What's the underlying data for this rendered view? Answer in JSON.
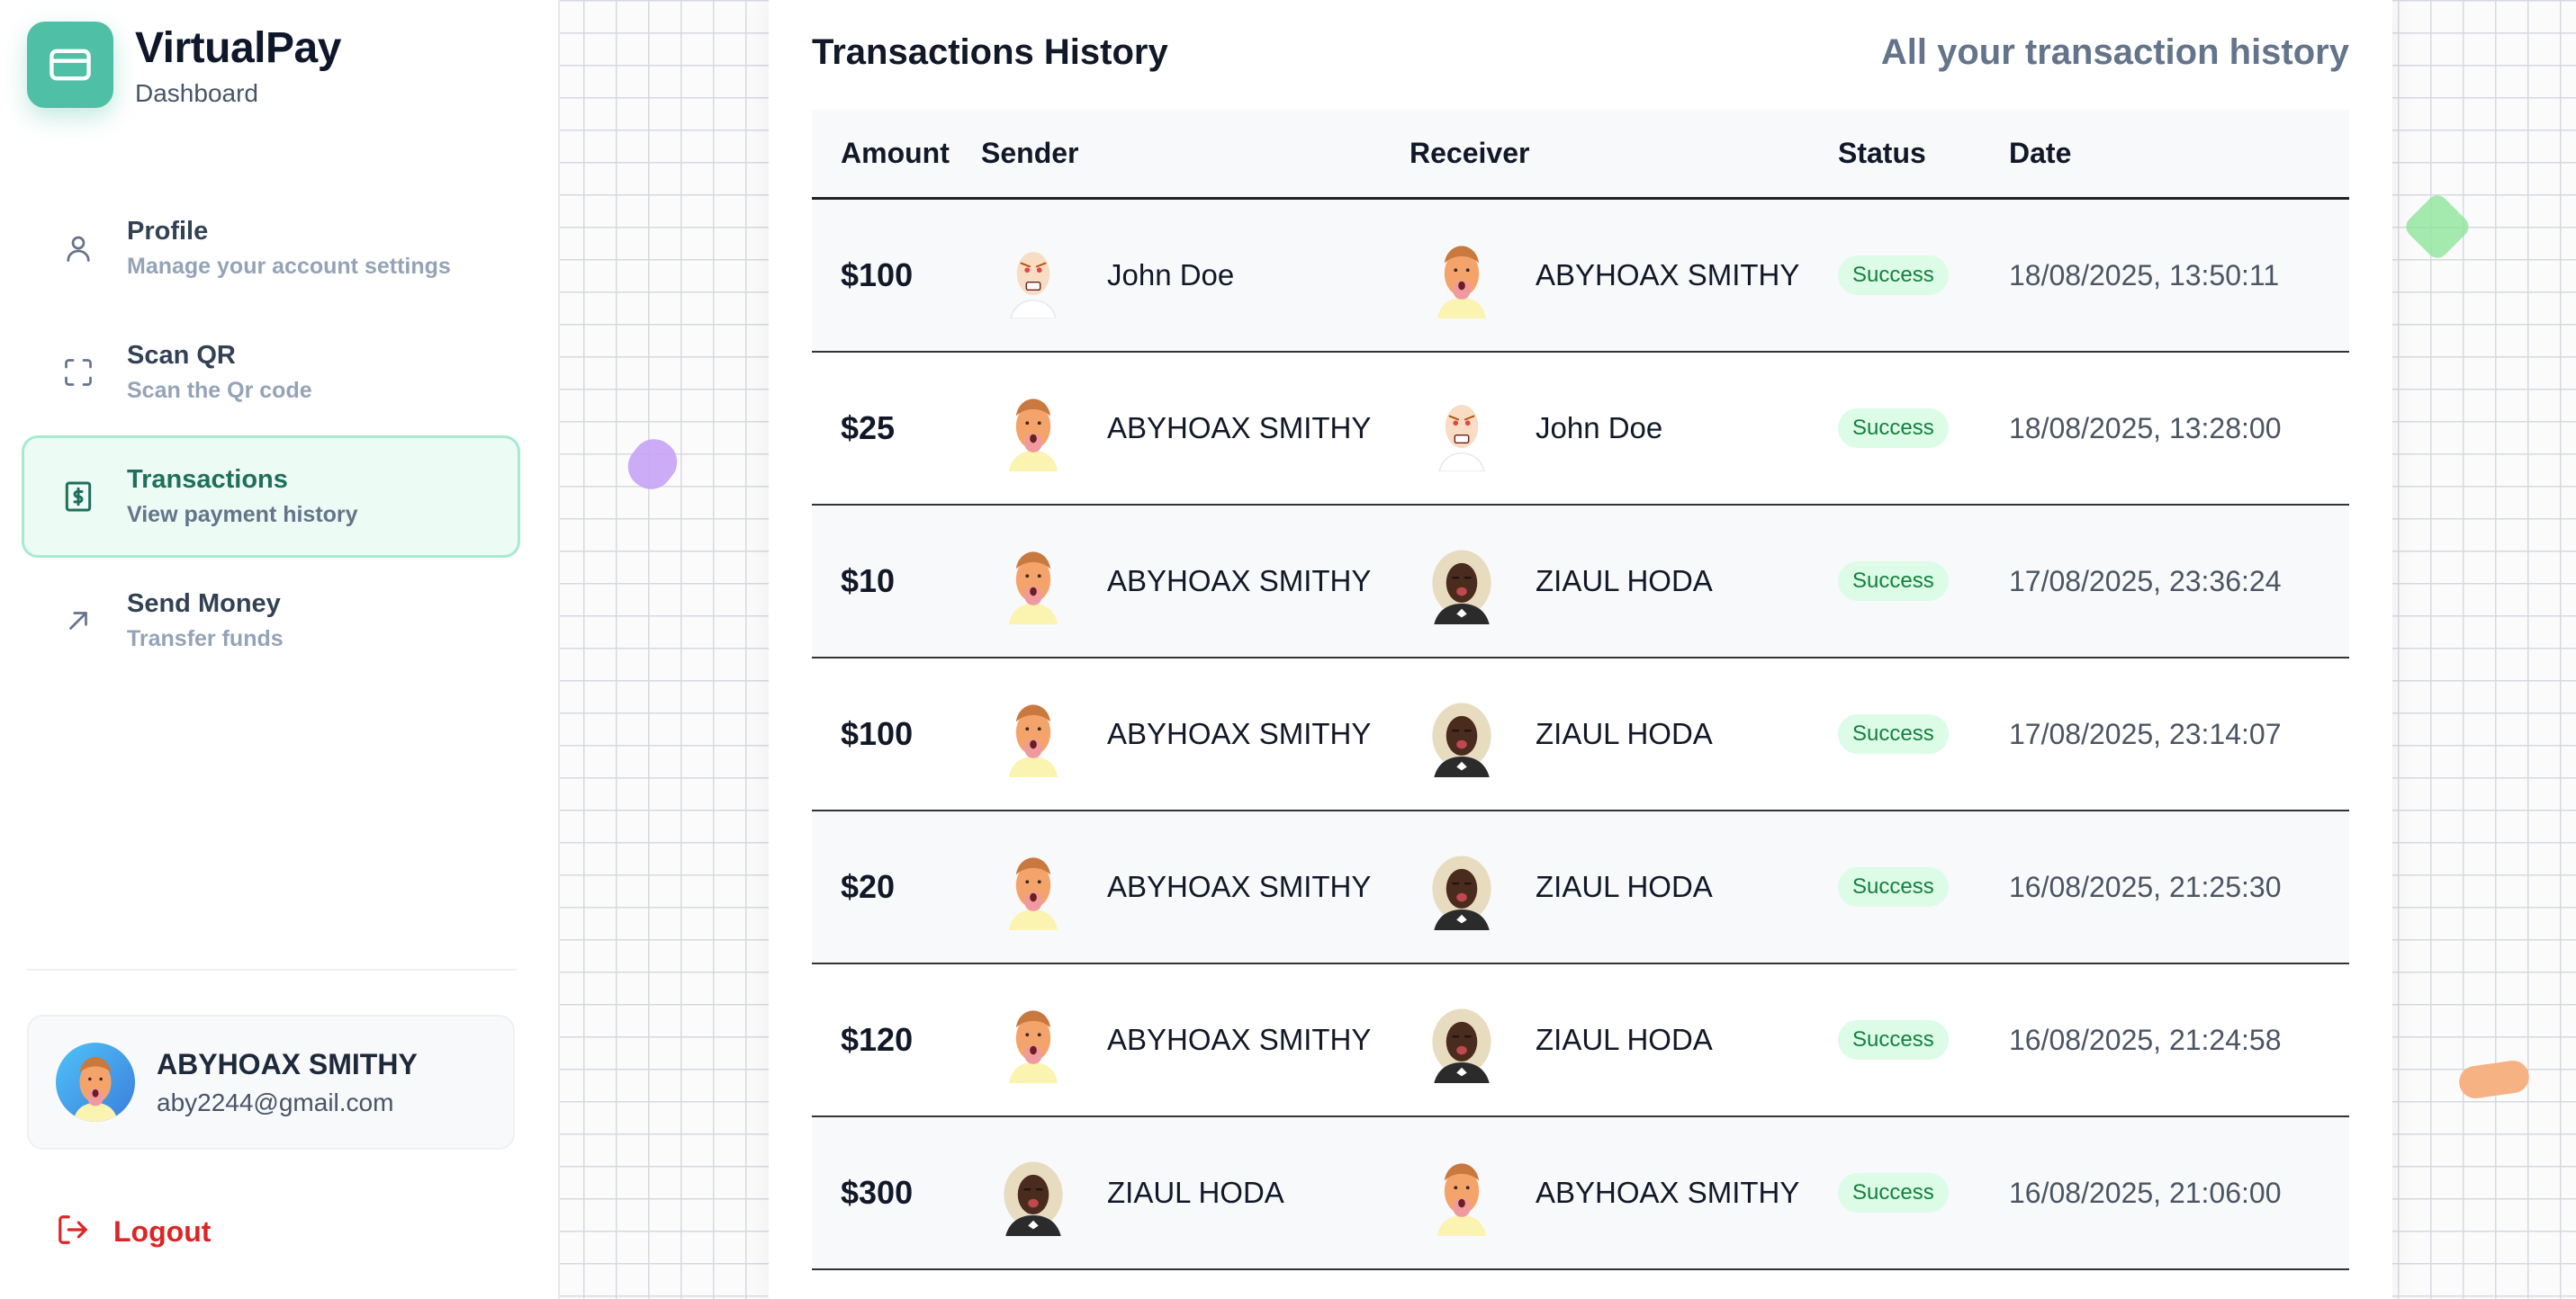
{
  "brand": {
    "title": "VirtualPay",
    "subtitle": "Dashboard"
  },
  "nav": [
    {
      "label": "Profile",
      "desc": "Manage your account settings",
      "icon": "user-icon",
      "active": false
    },
    {
      "label": "Scan QR",
      "desc": "Scan the Qr code",
      "icon": "scan-icon",
      "active": false
    },
    {
      "label": "Transactions",
      "desc": "View payment history",
      "icon": "receipt-dollar-icon",
      "active": true
    },
    {
      "label": "Send Money",
      "desc": "Transfer funds",
      "icon": "arrow-up-right-icon",
      "active": false
    }
  ],
  "user": {
    "name": "ABYHOAX SMITHY",
    "email": "aby2244@gmail.com"
  },
  "logout_label": "Logout",
  "main": {
    "title": "Transactions History",
    "subtitle": "All your transaction history"
  },
  "table": {
    "headers": {
      "amount": "Amount",
      "sender": "Sender",
      "receiver": "Receiver",
      "status": "Status",
      "date": "Date"
    },
    "rows": [
      {
        "amount": "$100",
        "sender": "John Doe",
        "receiver": "ABYHOAX SMITHY",
        "status": "Success",
        "date": "18/08/2025, 13:50:11"
      },
      {
        "amount": "$25",
        "sender": "ABYHOAX SMITHY",
        "receiver": "John Doe",
        "status": "Success",
        "date": "18/08/2025, 13:28:00"
      },
      {
        "amount": "$10",
        "sender": "ABYHOAX SMITHY",
        "receiver": "ZIAUL HODA",
        "status": "Success",
        "date": "17/08/2025, 23:36:24"
      },
      {
        "amount": "$100",
        "sender": "ABYHOAX SMITHY",
        "receiver": "ZIAUL HODA",
        "status": "Success",
        "date": "17/08/2025, 23:14:07"
      },
      {
        "amount": "$20",
        "sender": "ABYHOAX SMITHY",
        "receiver": "ZIAUL HODA",
        "status": "Success",
        "date": "16/08/2025, 21:25:30"
      },
      {
        "amount": "$120",
        "sender": "ABYHOAX SMITHY",
        "receiver": "ZIAUL HODA",
        "status": "Success",
        "date": "16/08/2025, 21:24:58"
      },
      {
        "amount": "$300",
        "sender": "ZIAUL HODA",
        "receiver": "ABYHOAX SMITHY",
        "status": "Success",
        "date": "16/08/2025, 21:06:00"
      }
    ]
  },
  "colors": {
    "accent": "#4fbfa5",
    "success_bg": "#dcfce7",
    "success_text": "#15803d",
    "danger": "#dc2626"
  }
}
